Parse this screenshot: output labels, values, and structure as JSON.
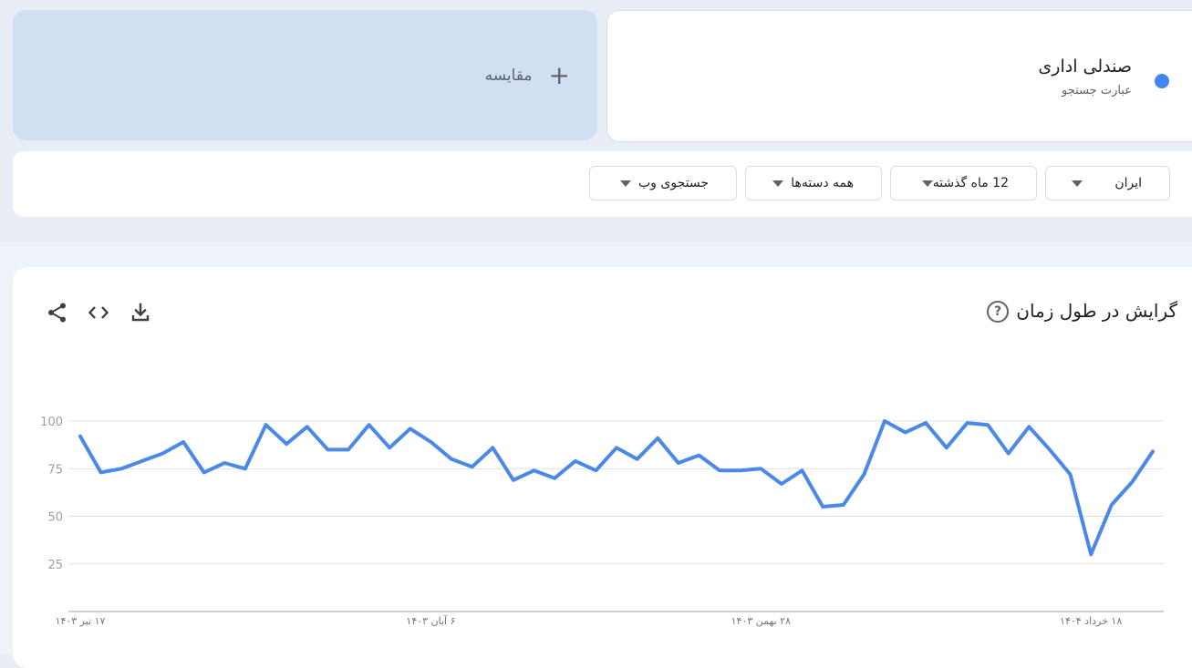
{
  "compare": {
    "plus": "+",
    "label": "مقایسه"
  },
  "term": {
    "title": "صندلی اداری",
    "subtitle": "عبارت جستجو",
    "color": "#4285f4"
  },
  "filters": [
    {
      "label": "ایران"
    },
    {
      "label": "12 ماه گذشته"
    },
    {
      "label": "همه دسته‌ها"
    },
    {
      "label": "جستجوی وب"
    }
  ],
  "chart_title": "گرایش در طول زمان",
  "help_glyph": "?",
  "icons": [
    "download-icon",
    "embed-icon",
    "share-icon"
  ],
  "chart_data": {
    "type": "line",
    "title": "گرایش در طول زمان",
    "ylim": [
      0,
      100
    ],
    "yticks": [
      100,
      75,
      50,
      25
    ],
    "xtick_labels": [
      "۱۷ تیر ۱۴۰۳",
      "۶ آبان ۱۴۰۳",
      "۲۸ بهمن ۱۴۰۳",
      "۱۸ خرداد ۱۴۰۴"
    ],
    "grid": true,
    "series": [
      {
        "name": "صندلی اداری",
        "color": "#4a89e8",
        "values": [
          92,
          73,
          75,
          79,
          83,
          89,
          73,
          78,
          75,
          98,
          88,
          97,
          85,
          85,
          98,
          86,
          96,
          89,
          80,
          76,
          86,
          69,
          74,
          70,
          79,
          74,
          86,
          80,
          91,
          78,
          82,
          74,
          74,
          75,
          67,
          74,
          55,
          56,
          72,
          100,
          94,
          99,
          86,
          99,
          98,
          83,
          97,
          85,
          72,
          30,
          56,
          68,
          84
        ]
      }
    ]
  }
}
